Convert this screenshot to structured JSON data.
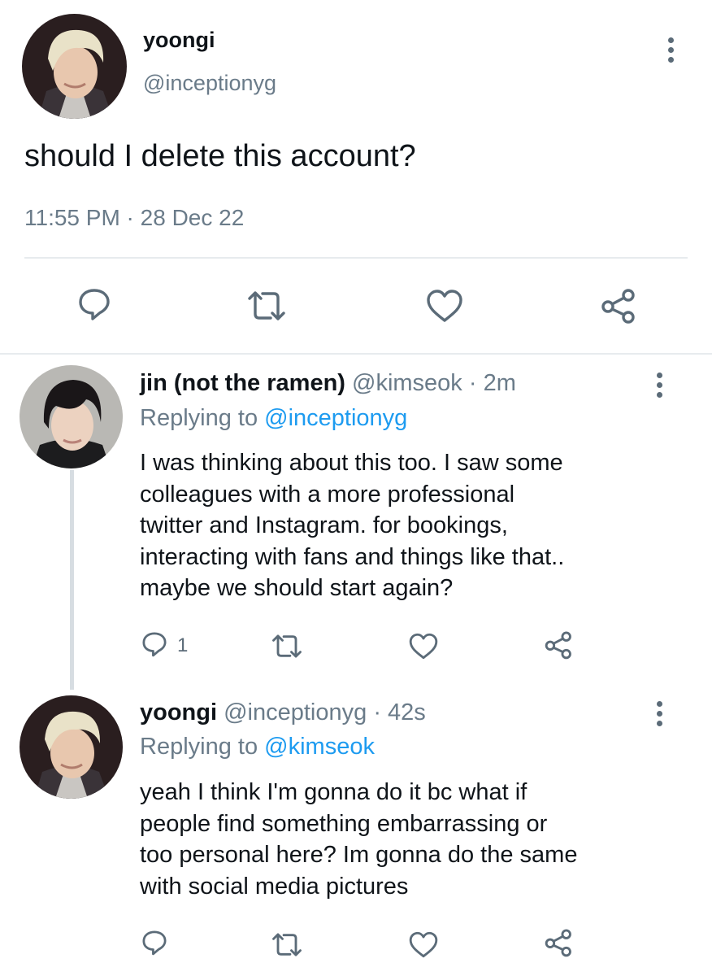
{
  "main_tweet": {
    "name": "yoongi",
    "handle": "@inceptionyg",
    "text": "should I delete this account?",
    "timestamp": "11:55 PM · 28 Dec 22"
  },
  "replies": [
    {
      "name": "jin (not the ramen)",
      "handle": "@kimseok · 2m",
      "replying_prefix": "Replying to ",
      "replying_handle": "@inceptionyg",
      "lines": [
        "I was thinking about this too. I saw some",
        "colleagues with a more professional",
        "twitter and Instagram. for bookings,",
        "interacting with fans and things like that..",
        "maybe we should start again?"
      ],
      "reply_count": "1"
    },
    {
      "name": "yoongi",
      "handle": "@inceptionyg · 42s",
      "replying_prefix": "Replying to ",
      "replying_handle": "@kimseok",
      "lines": [
        "yeah I think I'm gonna do it bc what if",
        "people find something embarrassing or",
        "too personal here? Im gonna do the same",
        "with social media pictures"
      ],
      "reply_count": ""
    }
  ],
  "icons": [
    "reply-icon",
    "retweet-icon",
    "like-icon",
    "share-icon",
    "more-icon"
  ],
  "colors": {
    "link": "#1d9bf0",
    "muted": "#6a7b89",
    "icon": "#5b6b78",
    "divider": "#e7ebee"
  }
}
